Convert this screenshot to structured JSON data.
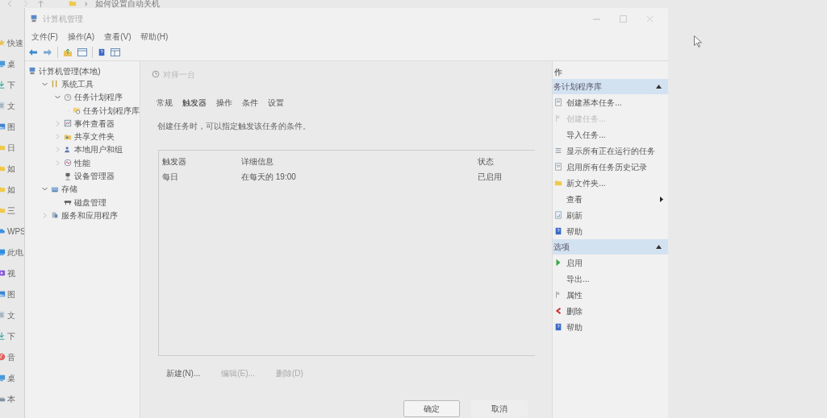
{
  "explorer": {
    "path_separator": "›",
    "path": "如何设置自动关机",
    "sidebar_items": [
      {
        "label": "快速",
        "kind": "star"
      },
      {
        "label": "桌",
        "kind": "desktop"
      },
      {
        "label": "下",
        "kind": "download"
      },
      {
        "label": "文",
        "kind": "document"
      },
      {
        "label": "图",
        "kind": "picture"
      },
      {
        "label": "日",
        "kind": "folder"
      },
      {
        "label": "如",
        "kind": "folder"
      },
      {
        "label": "如",
        "kind": "folder"
      },
      {
        "label": "三",
        "kind": "folder"
      },
      {
        "label": "WPS",
        "kind": "cloud"
      },
      {
        "label": "此电",
        "kind": "pc"
      },
      {
        "label": "视",
        "kind": "video"
      },
      {
        "label": "图",
        "kind": "picture"
      },
      {
        "label": "文",
        "kind": "document"
      },
      {
        "label": "下",
        "kind": "download"
      },
      {
        "label": "音",
        "kind": "music"
      },
      {
        "label": "桌",
        "kind": "desktop"
      },
      {
        "label": "本",
        "kind": "drive"
      }
    ]
  },
  "window": {
    "title": "计算机管理",
    "menu": [
      "文件(F)",
      "操作(A)",
      "查看(V)",
      "帮助(H)"
    ]
  },
  "tree": [
    {
      "label": "计算机管理(本地)",
      "kind": "computer",
      "children": [
        {
          "label": "系统工具",
          "kind": "tools",
          "expanded": true,
          "children": [
            {
              "label": "任务计划程序",
              "kind": "clock",
              "expanded": true,
              "children": [
                {
                  "label": "任务计划程序库",
                  "kind": "folder-clock",
                  "expanded": false
                }
              ]
            },
            {
              "label": "事件查看器",
              "kind": "event",
              "expanded": false
            },
            {
              "label": "共享文件夹",
              "kind": "share",
              "expanded": false
            },
            {
              "label": "本地用户和组",
              "kind": "users",
              "expanded": false
            },
            {
              "label": "性能",
              "kind": "perf",
              "expanded": false
            },
            {
              "label": "设备管理器",
              "kind": "device"
            }
          ]
        },
        {
          "label": "存储",
          "kind": "storage",
          "expanded": true,
          "children": [
            {
              "label": "磁盘管理",
              "kind": "disk"
            }
          ]
        },
        {
          "label": "服务和应用程序",
          "kind": "services",
          "expanded": false
        }
      ]
    }
  ],
  "dialog": {
    "title": "对择一台",
    "tabs": [
      {
        "label": "常规",
        "selected": false
      },
      {
        "label": "触发器",
        "selected": true
      },
      {
        "label": "操作",
        "selected": false
      },
      {
        "label": "条件",
        "selected": false
      },
      {
        "label": "设置",
        "selected": false
      }
    ],
    "description": "创建任务时，可以指定触发该任务的条件。",
    "table": {
      "columns": [
        "触发器",
        "详细信息",
        "状态"
      ],
      "rows": [
        [
          "每日",
          "在每天的 19:00",
          "已启用"
        ]
      ]
    },
    "buttons": [
      {
        "label": "新建(N)...",
        "disabled": false
      },
      {
        "label": "编辑(E)...",
        "disabled": true
      },
      {
        "label": "删除(D)",
        "disabled": true
      }
    ],
    "footer_buttons": [
      {
        "label": "确定",
        "default": true
      },
      {
        "label": "取消",
        "default": false
      }
    ]
  },
  "actions": {
    "header": "作",
    "sections": [
      {
        "title": "务计划程序库",
        "expanded": true,
        "items": [
          {
            "label": "创建基本任务...",
            "kind": "task",
            "disabled": false,
            "submenu": false
          },
          {
            "label": "创建任务...",
            "kind": "flag",
            "disabled": true,
            "submenu": false
          },
          {
            "label": "导入任务...",
            "kind": "none",
            "disabled": false,
            "submenu": false
          },
          {
            "label": "显示所有正在运行的任务",
            "kind": "list",
            "disabled": false,
            "submenu": false
          },
          {
            "label": "启用所有任务历史记录",
            "kind": "task",
            "disabled": false,
            "submenu": false
          },
          {
            "label": "新文件夹...",
            "kind": "folder",
            "disabled": false,
            "submenu": false
          },
          {
            "label": "查看",
            "kind": "none",
            "disabled": false,
            "submenu": true
          },
          {
            "label": "刷新",
            "kind": "refresh",
            "disabled": false,
            "submenu": false
          },
          {
            "label": "帮助",
            "kind": "help",
            "disabled": false,
            "submenu": false
          }
        ]
      },
      {
        "title": "选项",
        "expanded": true,
        "items": [
          {
            "label": "启用",
            "kind": "play",
            "disabled": false,
            "submenu": false
          },
          {
            "label": "导出...",
            "kind": "none",
            "disabled": false,
            "submenu": false
          },
          {
            "label": "属性",
            "kind": "flag",
            "disabled": false,
            "submenu": false
          },
          {
            "label": "删除",
            "kind": "delete",
            "disabled": false,
            "submenu": false
          },
          {
            "label": "帮助",
            "kind": "help",
            "disabled": false,
            "submenu": false
          }
        ]
      }
    ]
  }
}
